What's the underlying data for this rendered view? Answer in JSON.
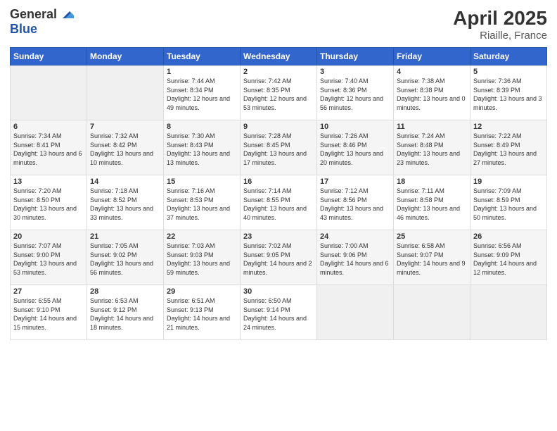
{
  "header": {
    "logo_general": "General",
    "logo_blue": "Blue",
    "title": "April 2025",
    "subtitle": "Riaille, France"
  },
  "weekdays": [
    "Sunday",
    "Monday",
    "Tuesday",
    "Wednesday",
    "Thursday",
    "Friday",
    "Saturday"
  ],
  "weeks": [
    [
      {
        "num": "",
        "sunrise": "",
        "sunset": "",
        "daylight": ""
      },
      {
        "num": "",
        "sunrise": "",
        "sunset": "",
        "daylight": ""
      },
      {
        "num": "1",
        "sunrise": "Sunrise: 7:44 AM",
        "sunset": "Sunset: 8:34 PM",
        "daylight": "Daylight: 12 hours and 49 minutes."
      },
      {
        "num": "2",
        "sunrise": "Sunrise: 7:42 AM",
        "sunset": "Sunset: 8:35 PM",
        "daylight": "Daylight: 12 hours and 53 minutes."
      },
      {
        "num": "3",
        "sunrise": "Sunrise: 7:40 AM",
        "sunset": "Sunset: 8:36 PM",
        "daylight": "Daylight: 12 hours and 56 minutes."
      },
      {
        "num": "4",
        "sunrise": "Sunrise: 7:38 AM",
        "sunset": "Sunset: 8:38 PM",
        "daylight": "Daylight: 13 hours and 0 minutes."
      },
      {
        "num": "5",
        "sunrise": "Sunrise: 7:36 AM",
        "sunset": "Sunset: 8:39 PM",
        "daylight": "Daylight: 13 hours and 3 minutes."
      }
    ],
    [
      {
        "num": "6",
        "sunrise": "Sunrise: 7:34 AM",
        "sunset": "Sunset: 8:41 PM",
        "daylight": "Daylight: 13 hours and 6 minutes."
      },
      {
        "num": "7",
        "sunrise": "Sunrise: 7:32 AM",
        "sunset": "Sunset: 8:42 PM",
        "daylight": "Daylight: 13 hours and 10 minutes."
      },
      {
        "num": "8",
        "sunrise": "Sunrise: 7:30 AM",
        "sunset": "Sunset: 8:43 PM",
        "daylight": "Daylight: 13 hours and 13 minutes."
      },
      {
        "num": "9",
        "sunrise": "Sunrise: 7:28 AM",
        "sunset": "Sunset: 8:45 PM",
        "daylight": "Daylight: 13 hours and 17 minutes."
      },
      {
        "num": "10",
        "sunrise": "Sunrise: 7:26 AM",
        "sunset": "Sunset: 8:46 PM",
        "daylight": "Daylight: 13 hours and 20 minutes."
      },
      {
        "num": "11",
        "sunrise": "Sunrise: 7:24 AM",
        "sunset": "Sunset: 8:48 PM",
        "daylight": "Daylight: 13 hours and 23 minutes."
      },
      {
        "num": "12",
        "sunrise": "Sunrise: 7:22 AM",
        "sunset": "Sunset: 8:49 PM",
        "daylight": "Daylight: 13 hours and 27 minutes."
      }
    ],
    [
      {
        "num": "13",
        "sunrise": "Sunrise: 7:20 AM",
        "sunset": "Sunset: 8:50 PM",
        "daylight": "Daylight: 13 hours and 30 minutes."
      },
      {
        "num": "14",
        "sunrise": "Sunrise: 7:18 AM",
        "sunset": "Sunset: 8:52 PM",
        "daylight": "Daylight: 13 hours and 33 minutes."
      },
      {
        "num": "15",
        "sunrise": "Sunrise: 7:16 AM",
        "sunset": "Sunset: 8:53 PM",
        "daylight": "Daylight: 13 hours and 37 minutes."
      },
      {
        "num": "16",
        "sunrise": "Sunrise: 7:14 AM",
        "sunset": "Sunset: 8:55 PM",
        "daylight": "Daylight: 13 hours and 40 minutes."
      },
      {
        "num": "17",
        "sunrise": "Sunrise: 7:12 AM",
        "sunset": "Sunset: 8:56 PM",
        "daylight": "Daylight: 13 hours and 43 minutes."
      },
      {
        "num": "18",
        "sunrise": "Sunrise: 7:11 AM",
        "sunset": "Sunset: 8:58 PM",
        "daylight": "Daylight: 13 hours and 46 minutes."
      },
      {
        "num": "19",
        "sunrise": "Sunrise: 7:09 AM",
        "sunset": "Sunset: 8:59 PM",
        "daylight": "Daylight: 13 hours and 50 minutes."
      }
    ],
    [
      {
        "num": "20",
        "sunrise": "Sunrise: 7:07 AM",
        "sunset": "Sunset: 9:00 PM",
        "daylight": "Daylight: 13 hours and 53 minutes."
      },
      {
        "num": "21",
        "sunrise": "Sunrise: 7:05 AM",
        "sunset": "Sunset: 9:02 PM",
        "daylight": "Daylight: 13 hours and 56 minutes."
      },
      {
        "num": "22",
        "sunrise": "Sunrise: 7:03 AM",
        "sunset": "Sunset: 9:03 PM",
        "daylight": "Daylight: 13 hours and 59 minutes."
      },
      {
        "num": "23",
        "sunrise": "Sunrise: 7:02 AM",
        "sunset": "Sunset: 9:05 PM",
        "daylight": "Daylight: 14 hours and 2 minutes."
      },
      {
        "num": "24",
        "sunrise": "Sunrise: 7:00 AM",
        "sunset": "Sunset: 9:06 PM",
        "daylight": "Daylight: 14 hours and 6 minutes."
      },
      {
        "num": "25",
        "sunrise": "Sunrise: 6:58 AM",
        "sunset": "Sunset: 9:07 PM",
        "daylight": "Daylight: 14 hours and 9 minutes."
      },
      {
        "num": "26",
        "sunrise": "Sunrise: 6:56 AM",
        "sunset": "Sunset: 9:09 PM",
        "daylight": "Daylight: 14 hours and 12 minutes."
      }
    ],
    [
      {
        "num": "27",
        "sunrise": "Sunrise: 6:55 AM",
        "sunset": "Sunset: 9:10 PM",
        "daylight": "Daylight: 14 hours and 15 minutes."
      },
      {
        "num": "28",
        "sunrise": "Sunrise: 6:53 AM",
        "sunset": "Sunset: 9:12 PM",
        "daylight": "Daylight: 14 hours and 18 minutes."
      },
      {
        "num": "29",
        "sunrise": "Sunrise: 6:51 AM",
        "sunset": "Sunset: 9:13 PM",
        "daylight": "Daylight: 14 hours and 21 minutes."
      },
      {
        "num": "30",
        "sunrise": "Sunrise: 6:50 AM",
        "sunset": "Sunset: 9:14 PM",
        "daylight": "Daylight: 14 hours and 24 minutes."
      },
      {
        "num": "",
        "sunrise": "",
        "sunset": "",
        "daylight": ""
      },
      {
        "num": "",
        "sunrise": "",
        "sunset": "",
        "daylight": ""
      },
      {
        "num": "",
        "sunrise": "",
        "sunset": "",
        "daylight": ""
      }
    ]
  ]
}
